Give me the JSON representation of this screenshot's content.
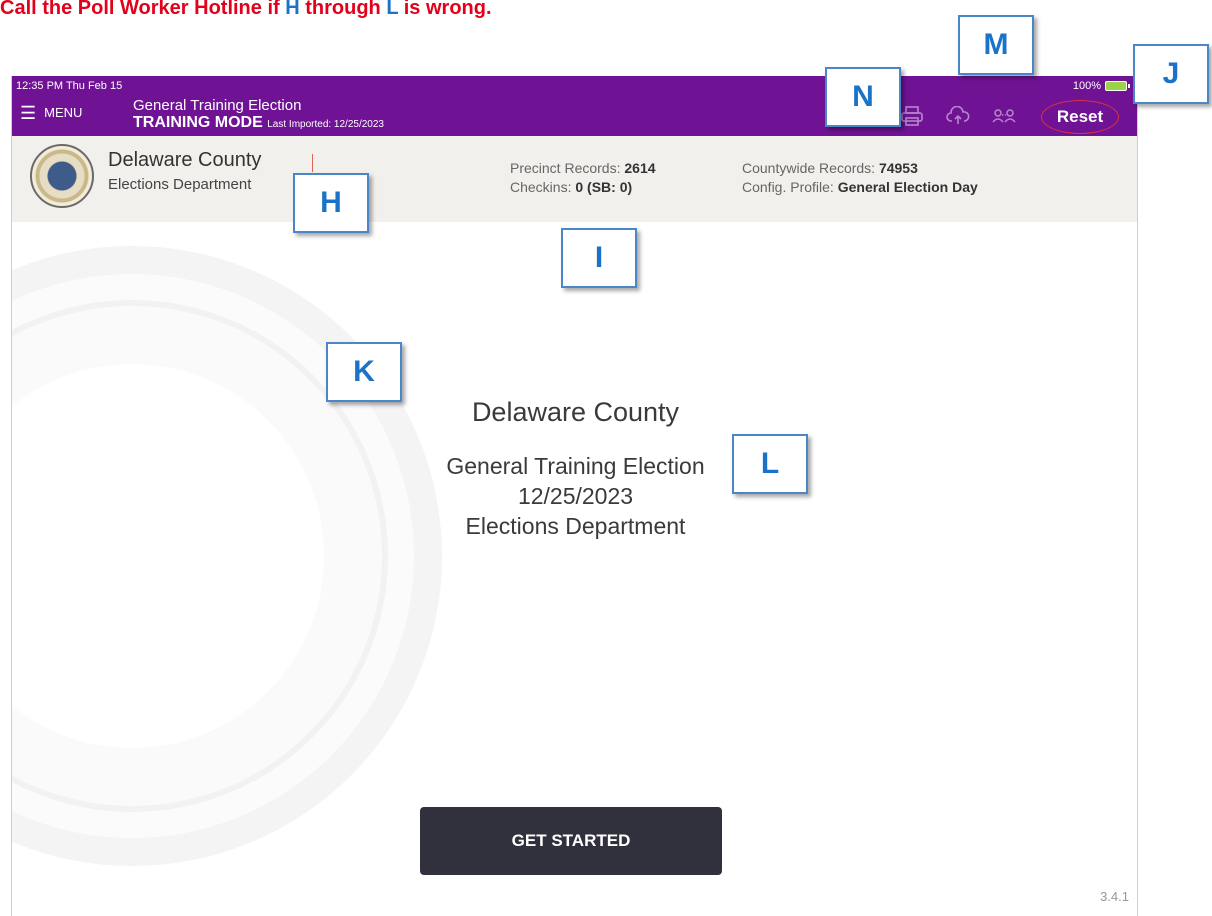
{
  "instruction": {
    "prefix": "Call the Poll Worker Hotline if ",
    "from_letter": "H",
    "middle": " through ",
    "to_letter": "L",
    "suffix": " is wrong."
  },
  "status": {
    "time": "12:35 PM  Thu Feb 15",
    "battery": "100%"
  },
  "nav": {
    "menu_label": "MENU",
    "election_name": "General Training Election",
    "mode": "TRAINING MODE",
    "imported": "Last Imported: 12/25/2023",
    "reset_label": "Reset"
  },
  "header": {
    "county": "Delaware County",
    "department": "Elections Department",
    "precinct_label": "Precinct Records:",
    "precinct_value": "2614",
    "checkins_label": "Checkins:",
    "checkins_value": "0",
    "sb_value": "(SB: 0)",
    "countywide_label": "Countywide Records:",
    "countywide_value": "74953",
    "config_label": "Config. Profile:",
    "config_value": "General Election Day"
  },
  "main": {
    "county": "Delaware County",
    "election": "General Training Election",
    "date": "12/25/2023",
    "department": "Elections Department",
    "start_label": "GET STARTED",
    "version": "3.4.1"
  },
  "icons": [
    "print-icon",
    "cloud-upload-icon",
    "users-icon",
    "menu-icon",
    "battery-icon"
  ],
  "callouts": [
    "H",
    "I",
    "J",
    "K",
    "L",
    "M",
    "N"
  ],
  "colors": {
    "nav_purple": "#6f1394",
    "instruction_red": "#e3001b",
    "callout_blue": "#1a73c8",
    "button_dark": "#31303d"
  }
}
